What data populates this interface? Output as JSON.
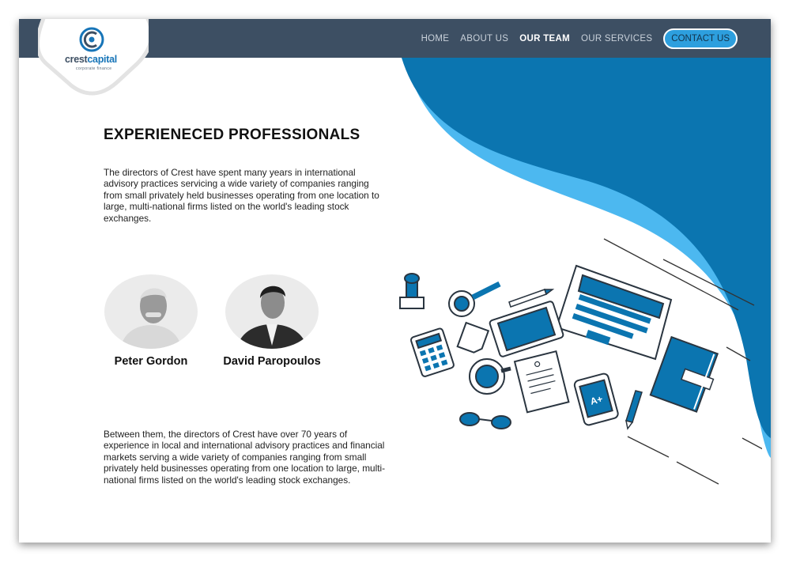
{
  "brand": {
    "name_part1": "crest",
    "name_part2": "capital",
    "tagline": "corporate finance"
  },
  "nav": {
    "items": [
      "HOME",
      "ABOUT US",
      "OUR TEAM",
      "OUR SERVICES"
    ],
    "active": "OUR TEAM",
    "contact_label": "CONTACT US"
  },
  "main": {
    "heading": "EXPERIENECED PROFESSIONALS",
    "intro": "The directors of Crest have spent many years in international advisory practices servicing a wide variety of companies ranging from small privately held businesses operating from one location to large, multi-national firms listed on the world's leading stock exchanges.",
    "team": [
      {
        "name": "Peter Gordon"
      },
      {
        "name": "David Paropoulos"
      }
    ],
    "outro": "Between them, the directors of Crest have over 70 years of experience in local and international advisory practices and financial markets serving a wide variety of companies ranging from small privately held businesses operating from one location to large, multi-national firms listed on the world's leading stock exchanges."
  },
  "illustration": {
    "tablet_grade": "A+"
  },
  "colors": {
    "nav_bg": "#3d4f63",
    "brand_blue": "#0b75b0",
    "light_blue": "#4cb8f0",
    "contact_bg": "#2d9fde"
  }
}
